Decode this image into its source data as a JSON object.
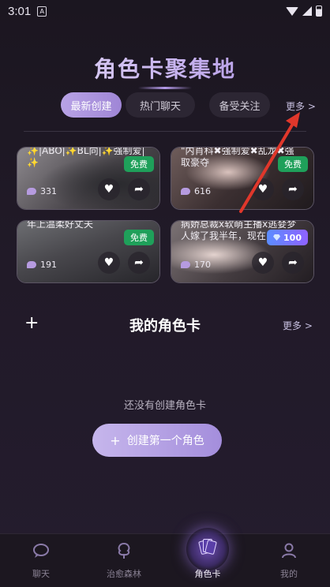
{
  "status_bar": {
    "time": "3:01",
    "notify_glyph": "A"
  },
  "header": {
    "title": "角色卡聚集地"
  },
  "tabs": [
    {
      "label": "最新创建",
      "active": true
    },
    {
      "label": "热门聊天",
      "active": false
    },
    {
      "label": "备受关注",
      "active": false
    }
  ],
  "more_label": "更多 >",
  "cards": [
    {
      "text_line1": "✨|ABO|✨BL向|✨强制爱|",
      "text_line2": "✨",
      "badge": "免费",
      "badge_type": "free",
      "count": "331",
      "bg": "#5c5a60"
    },
    {
      "text_line1": "\"内肖科✖强制爱✖乱龙✖强",
      "text_line2": "取豪夺",
      "badge": "免费",
      "badge_type": "free",
      "count": "616",
      "bg": "#6b5a5a"
    },
    {
      "text_line1": "年上温柔好丈夫",
      "text_line2": "",
      "badge": "免费",
      "badge_type": "free",
      "count": "191",
      "bg": "#555357"
    },
    {
      "text_line1": "病娇总裁x软萌主播x逃婪梦",
      "text_line2": "人嫁了我半年，现在",
      "badge": "100",
      "badge_type": "gem",
      "count": "170",
      "bg": "#6a6266"
    }
  ],
  "my_cards": {
    "plus": "+",
    "title": "我的角色卡",
    "more": "更多 >",
    "empty_text": "还没有创建角色卡",
    "create_button": "创建第一个角色",
    "create_plus": "+"
  },
  "bottom_nav": [
    {
      "label": "聊天",
      "icon": "chat-bubble-icon",
      "active": false
    },
    {
      "label": "治愈森林",
      "icon": "tree-icon",
      "active": false
    },
    {
      "label": "角色卡",
      "icon": "cards-icon",
      "active": true
    },
    {
      "label": "我的",
      "icon": "person-icon",
      "active": false
    }
  ],
  "colors": {
    "accent": "#a48edc",
    "free_badge": "#1fa05a",
    "annotation_arrow": "#e0372b"
  }
}
